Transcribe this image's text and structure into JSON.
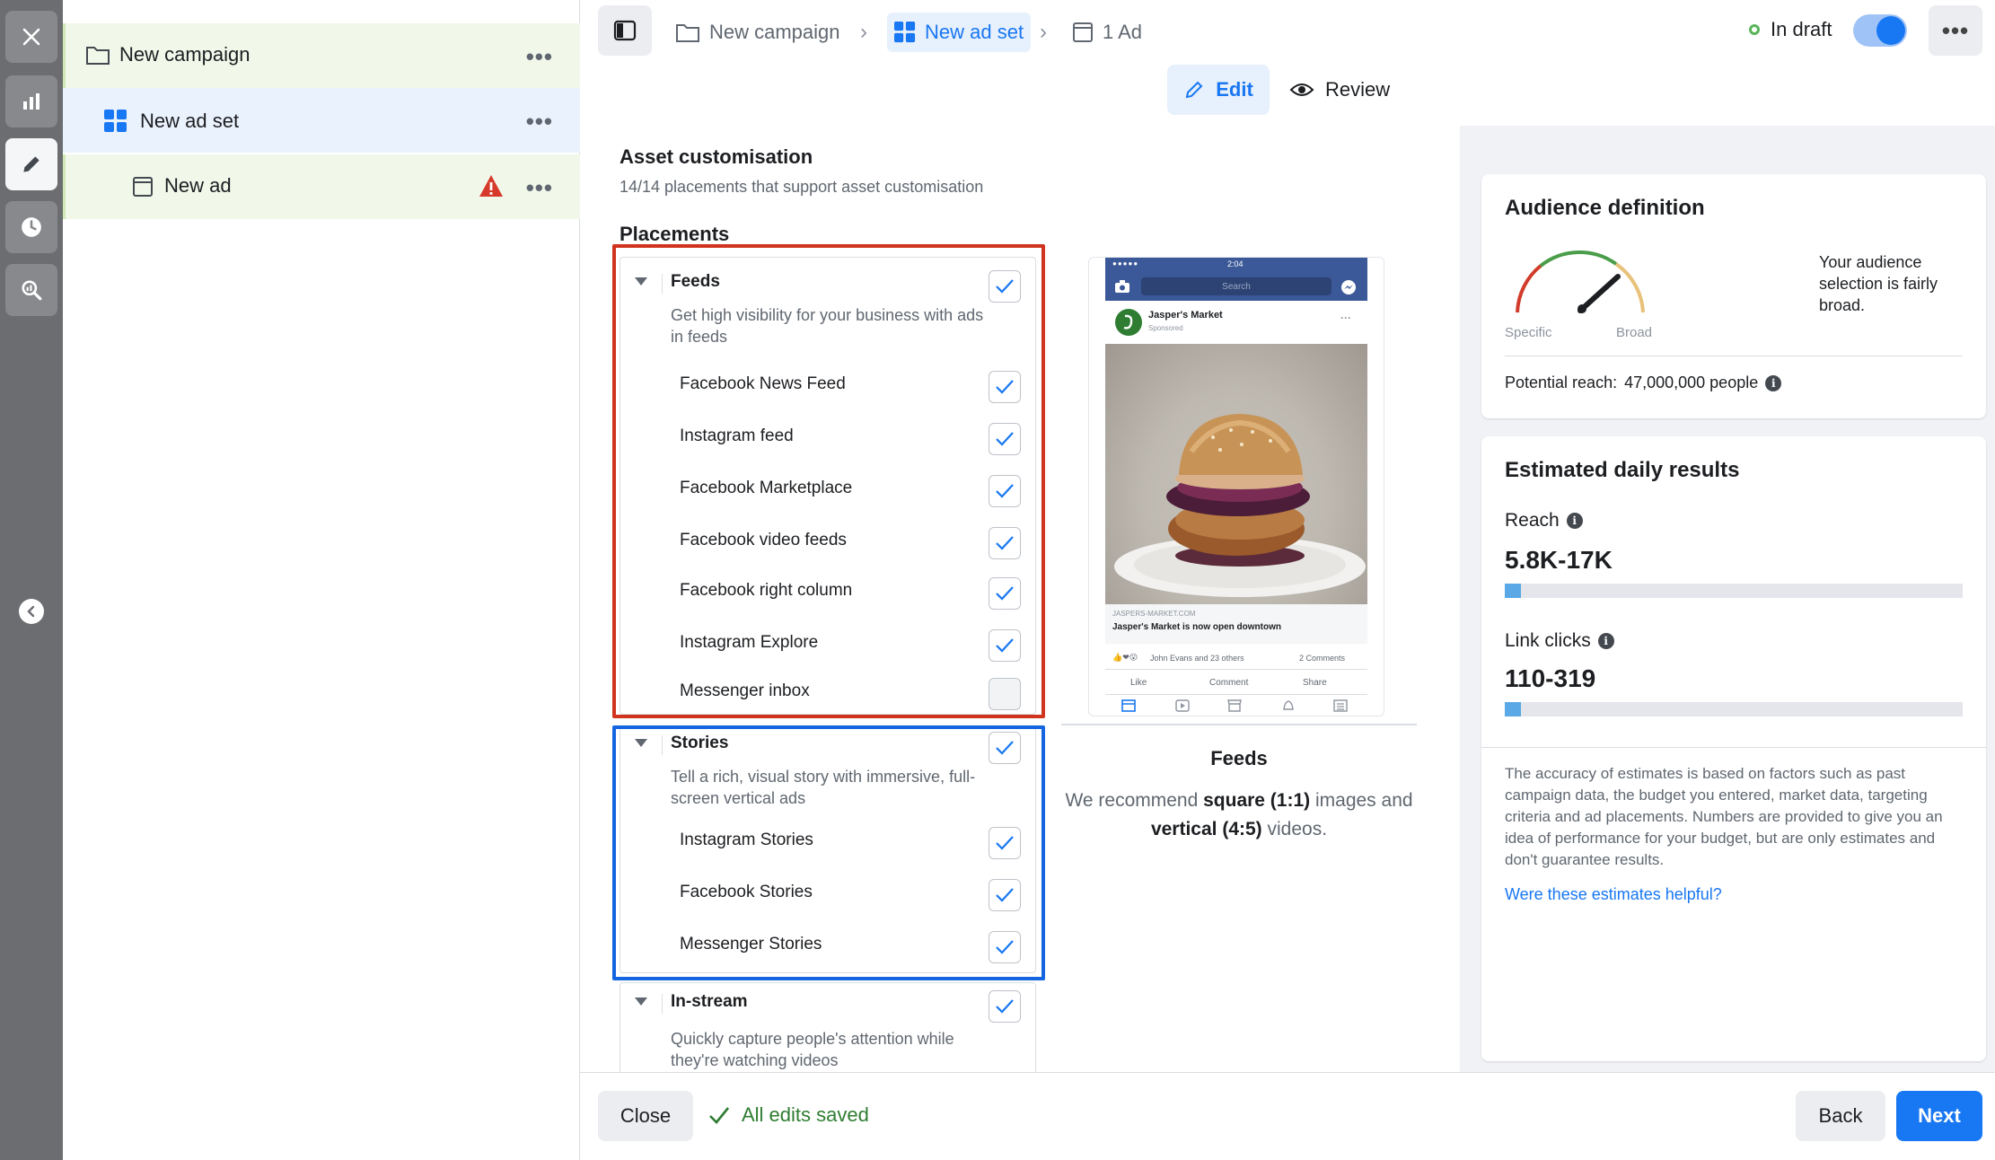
{
  "breadcrumb": {
    "campaign": "New campaign",
    "ad_set": "New ad set",
    "ad": "1 Ad"
  },
  "status": {
    "label": "In draft",
    "toggle_on": true
  },
  "tabs": {
    "edit": "Edit",
    "review": "Review"
  },
  "tree": {
    "campaign": "New campaign",
    "ad_set": "New ad set",
    "ad": "New ad"
  },
  "asset_customisation": {
    "title": "Asset customisation",
    "subtitle": "14/14 placements that support asset customisation"
  },
  "placements": {
    "title": "Placements",
    "groups": [
      {
        "name": "Feeds",
        "description": "Get high visibility for your business with ads in feeds",
        "checked": true,
        "items": [
          {
            "label": "Facebook News Feed",
            "checked": true
          },
          {
            "label": "Instagram feed",
            "checked": true
          },
          {
            "label": "Facebook Marketplace",
            "checked": true
          },
          {
            "label": "Facebook video feeds",
            "checked": true
          },
          {
            "label": "Facebook right column",
            "checked": true
          },
          {
            "label": "Instagram Explore",
            "checked": true
          },
          {
            "label": "Messenger inbox",
            "checked": false
          }
        ]
      },
      {
        "name": "Stories",
        "description": "Tell a rich, visual story with immersive, full-screen vertical ads",
        "checked": true,
        "items": [
          {
            "label": "Instagram Stories",
            "checked": true
          },
          {
            "label": "Facebook Stories",
            "checked": true
          },
          {
            "label": "Messenger Stories",
            "checked": true
          }
        ]
      },
      {
        "name": "In-stream",
        "description": "Quickly capture people's attention while they're watching videos",
        "checked": true,
        "items": []
      }
    ]
  },
  "preview": {
    "page_name": "Jasper's Market",
    "sponsored": "Sponsored",
    "time": "2:04",
    "search": "Search",
    "link_domain": "JASPERS-MARKET.COM",
    "link_headline": "Jasper's Market is now open downtown",
    "reactions": "John Evans and 23 others",
    "comments": "2 Comments",
    "like": "Like",
    "comment": "Comment",
    "share": "Share",
    "title": "Feeds",
    "rec_prefix": "We recommend ",
    "rec_square": "square (1:1)",
    "rec_mid": " images and ",
    "rec_vertical": "vertical (4:5)",
    "rec_suffix": " videos."
  },
  "audience": {
    "title": "Audience definition",
    "specific": "Specific",
    "broad": "Broad",
    "description": "Your audience selection is fairly broad.",
    "potential_reach_label": "Potential reach:",
    "potential_reach_value": "47,000,000 people"
  },
  "estimates": {
    "title": "Estimated daily results",
    "reach_label": "Reach",
    "reach_value": "5.8K-17K",
    "reach_fill": 0.035,
    "clicks_label": "Link clicks",
    "clicks_value": "110-319",
    "clicks_fill": 0.035,
    "disclaimer": "The accuracy of estimates is based on factors such as past campaign data, the budget you entered, market data, targeting criteria and ad placements. Numbers are provided to give you an idea of performance for your budget, but are only estimates and don't guarantee results.",
    "helpful_link": "Were these estimates helpful?"
  },
  "footer": {
    "close": "Close",
    "saved": "All edits saved",
    "back": "Back",
    "next": "Next"
  },
  "colors": {
    "primary": "#1877f2",
    "feeds_highlight": "#d0341f",
    "stories_highlight": "#1565e0",
    "draft_dot": "#5ab55a",
    "warning": "#d63a2a"
  }
}
